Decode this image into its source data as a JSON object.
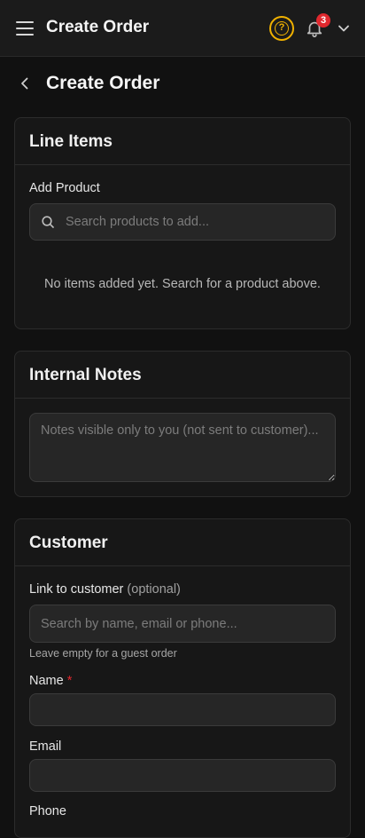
{
  "topbar": {
    "title": "Create Order",
    "help_glyph": "?",
    "notification_count": "3",
    "icons": [
      "menu-icon",
      "help-icon",
      "bell-icon",
      "chevron-down-icon"
    ],
    "accent_color": "#f0b100",
    "badge_color": "#e0282e"
  },
  "page": {
    "title": "Create Order"
  },
  "line_items": {
    "title": "Line Items",
    "add_product_label": "Add Product",
    "search_placeholder": "Search products to add...",
    "empty_message": "No items added yet. Search for a product above."
  },
  "internal_notes": {
    "title": "Internal Notes",
    "placeholder": "Notes visible only to you (not sent to customer)..."
  },
  "customer": {
    "title": "Customer",
    "link_label": "Link to customer",
    "link_optional": "(optional)",
    "link_placeholder": "Search by name, email or phone...",
    "link_hint": "Leave empty for a guest order",
    "name_label": "Name",
    "required_marker": "*",
    "name_value": "",
    "email_label": "Email",
    "email_value": "",
    "phone_label": "Phone"
  }
}
